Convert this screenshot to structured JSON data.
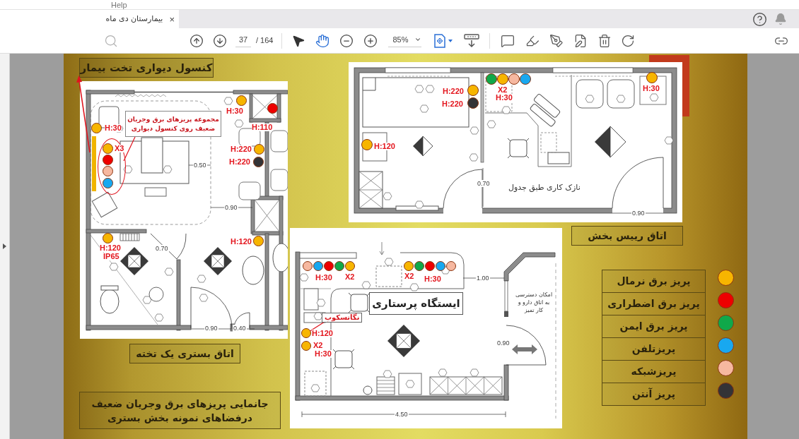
{
  "menu_bar": {
    "items": [
      "Help"
    ]
  },
  "tabs": [
    {
      "title": "بیمارستان دی ماه",
      "close": "×",
      "selected": true
    }
  ],
  "toolbar": {
    "page": "37",
    "page_total": "/ 164",
    "zoom": "85%",
    "tools": [
      {
        "kind": "select",
        "selected": false
      },
      {
        "kind": "hand",
        "selected": true
      }
    ]
  },
  "slide": {
    "console_title": "کنسول دیواری تخت بیمار",
    "ward_room": {
      "callout": [
        "مجموعه پریزهای برق وجریان",
        "ضعیف روی کنسول دیواری"
      ],
      "outlets": [
        {
          "color": "#f7b500"
        },
        {
          "color": "#ee0000"
        },
        {
          "color": "#f7b500"
        },
        {
          "color": "#f7b500"
        },
        {
          "color": "#ee0000"
        },
        {
          "color": "#f6b8a0"
        },
        {
          "color": "#18a8f0"
        },
        {
          "color": "#f7b500"
        },
        {
          "color": "#333336"
        },
        {
          "color": "#f7b500"
        },
        {
          "color": "#f7b500"
        }
      ],
      "labels": [
        {
          "text": "H:30",
          "kind": "height"
        },
        {
          "text": "H:110",
          "kind": "height"
        },
        {
          "text": "H:30",
          "kind": "height"
        },
        {
          "text": "H:220",
          "kind": "height"
        },
        {
          "text": "X3",
          "kind": "height"
        },
        {
          "text": "H:220",
          "kind": "height"
        },
        {
          "text": "0.50",
          "kind": "dimension"
        },
        {
          "text": "0.90",
          "kind": "dimension"
        },
        {
          "text": "H:120",
          "kind": "height"
        },
        {
          "text": "0.70",
          "kind": "dimension"
        },
        {
          "text": "H:120",
          "kind": "height"
        },
        {
          "text": "IP65",
          "kind": "height"
        },
        {
          "text": "0.40",
          "kind": "dimension"
        },
        {
          "text": "0.90",
          "kind": "dimension"
        }
      ]
    },
    "ward_room_caption": "اتاق بستری یک تخته",
    "summary": [
      "جانمایی پریزهای برق وجریان ضعیف",
      "درفضاهای نمونه بخش بستری"
    ],
    "head_office": {
      "outlets": [
        {
          "color": "#10a84a"
        },
        {
          "color": "#f7b500"
        },
        {
          "color": "#f6b8a0"
        },
        {
          "color": "#18a8f0"
        },
        {
          "color": "#f7b500"
        },
        {
          "color": "#333336"
        },
        {
          "color": "#f7b500"
        },
        {
          "color": "#f7b500"
        }
      ],
      "labels": [
        {
          "text": "H:30",
          "kind": "height"
        },
        {
          "text": "X2",
          "kind": "height"
        },
        {
          "text": "H:220",
          "kind": "height"
        },
        {
          "text": "H:30",
          "kind": "height"
        },
        {
          "text": "H:220",
          "kind": "height"
        },
        {
          "text": "H:120",
          "kind": "height"
        },
        {
          "text": "نازک کاری طبق جدول",
          "kind": "note"
        },
        {
          "text": "0.70",
          "kind": "dimension"
        },
        {
          "text": "0.90",
          "kind": "dimension"
        }
      ]
    },
    "head_office_caption": "اتاق رییس بخش",
    "nursing_station": {
      "title": "ایستگاه پرستاری",
      "access_note": [
        "امکان دسترسی",
        "به اتاق دارو و",
        "کار تمیز"
      ],
      "outlets": [
        {
          "color": "#f6b8a0"
        },
        {
          "color": "#18a8f0"
        },
        {
          "color": "#ee0000"
        },
        {
          "color": "#10a84a"
        },
        {
          "color": "#f7b500"
        },
        {
          "color": "#f7b500"
        },
        {
          "color": "#10a84a"
        },
        {
          "color": "#ee0000"
        },
        {
          "color": "#18a8f0"
        },
        {
          "color": "#f6b8a0"
        },
        {
          "color": "#f7b500"
        },
        {
          "color": "#f7b500"
        }
      ],
      "labels": [
        {
          "text": "1.00",
          "kind": "dimension"
        },
        {
          "text": "H:30",
          "kind": "height"
        },
        {
          "text": "X2",
          "kind": "height"
        },
        {
          "text": "X2",
          "kind": "height"
        },
        {
          "text": "H:30",
          "kind": "height"
        },
        {
          "text": "نگاتسکوپ",
          "kind": "tag"
        },
        {
          "text": "H:120",
          "kind": "height"
        },
        {
          "text": "0.90",
          "kind": "dimension"
        },
        {
          "text": "X2",
          "kind": "height"
        },
        {
          "text": "H:30",
          "kind": "height"
        },
        {
          "text": "4.50",
          "kind": "dimension"
        }
      ]
    },
    "legend": [
      {
        "label": "پریز برق نرمال",
        "color": "#f7b500"
      },
      {
        "label": "پریز برق اضطراری",
        "color": "#ee0000"
      },
      {
        "label": "پریز برق ایمن",
        "color": "#10a84a"
      },
      {
        "label": "پریزتلفن",
        "color": "#18a8f0"
      },
      {
        "label": "پریزشبکه",
        "color": "#f6b8a0"
      },
      {
        "label": "پریز آنتن",
        "color": "#333336"
      }
    ]
  }
}
